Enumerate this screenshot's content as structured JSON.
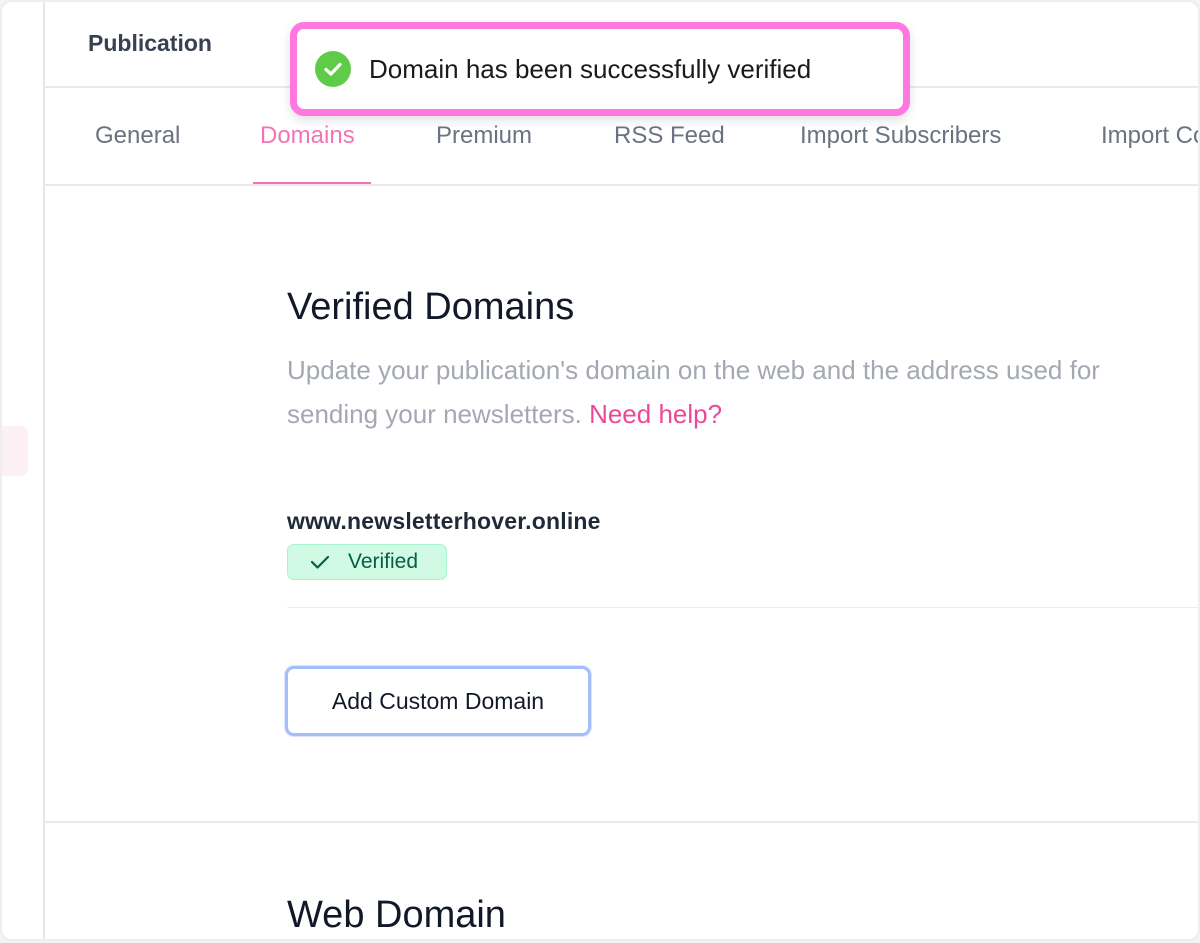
{
  "header": {
    "title": "Publication"
  },
  "toast": {
    "message": "Domain has been successfully verified",
    "icon": "check-circle-icon",
    "color": "#5fcc49",
    "border_color": "#ff77e0"
  },
  "tabs": [
    {
      "label": "General",
      "active": false
    },
    {
      "label": "Domains",
      "active": true
    },
    {
      "label": "Premium",
      "active": false
    },
    {
      "label": "RSS Feed",
      "active": false
    },
    {
      "label": "Import Subscribers",
      "active": false
    },
    {
      "label": "Import Content",
      "active": false
    }
  ],
  "verified_domains": {
    "title": "Verified Domains",
    "description": "Update your publication's domain on the web and the address used for",
    "description_line2": "sending your newsletters.",
    "help_link": "Need help?",
    "domains": [
      {
        "name": "www.newsletterhover.online",
        "status": "Verified"
      }
    ],
    "add_button": "Add Custom Domain"
  },
  "web_domain": {
    "title": "Web Domain"
  },
  "colors": {
    "accent": "#f472b6",
    "link": "#ec4899",
    "badge_bg": "#d1fae5",
    "badge_text": "#065f46"
  }
}
